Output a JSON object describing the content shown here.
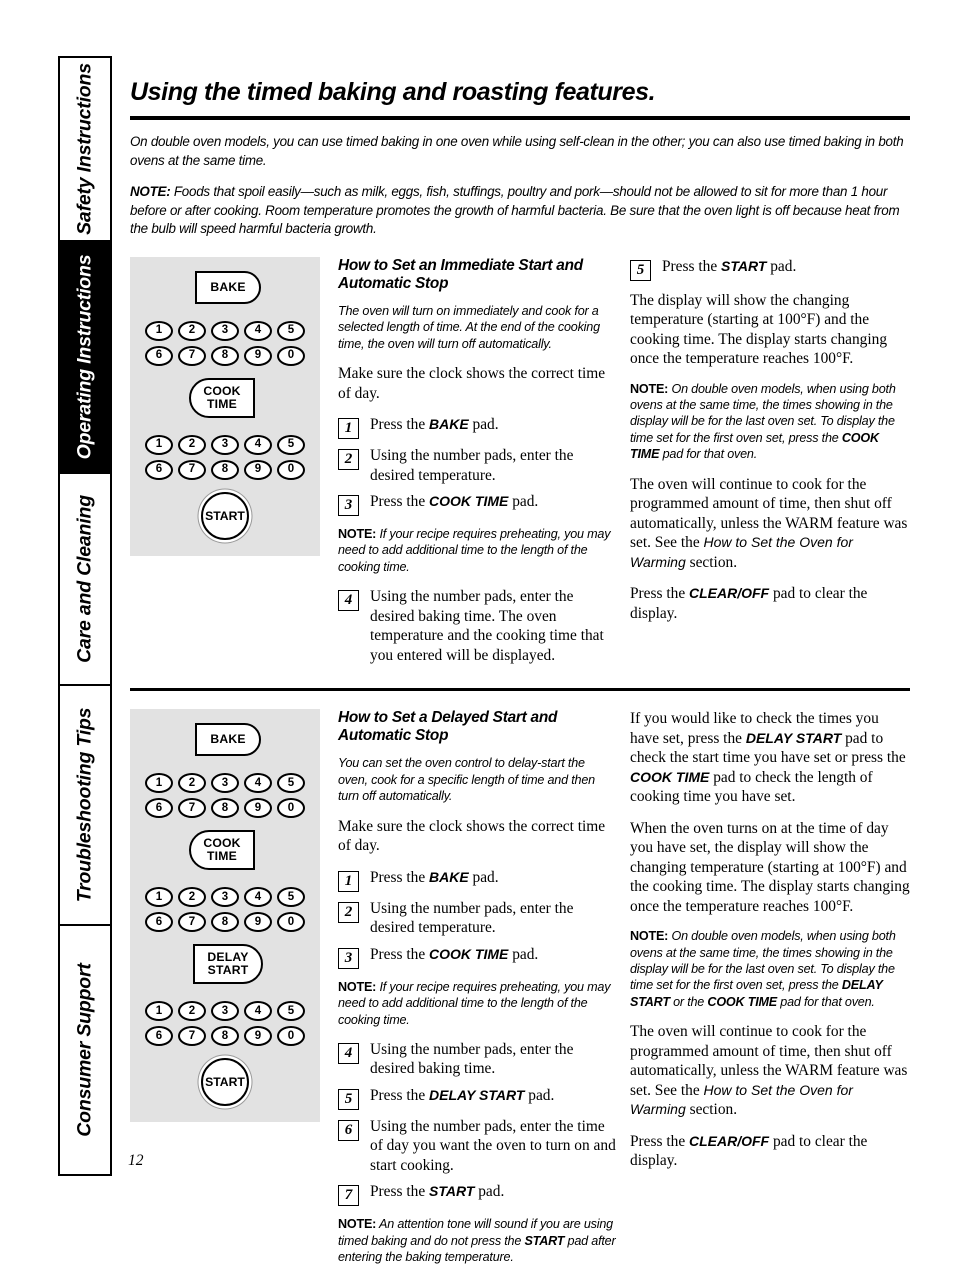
{
  "sidebar": {
    "tabs": [
      {
        "label": "Safety Instructions",
        "active": false
      },
      {
        "label": "Operating Instructions",
        "active": true
      },
      {
        "label": "Care and Cleaning",
        "active": false
      },
      {
        "label": "Troubleshooting Tips",
        "active": false
      },
      {
        "label": "Consumer Support",
        "active": false
      }
    ]
  },
  "page": {
    "title": "Using the timed baking and roasting features.",
    "number": "12",
    "intro": "On double oven models, you can use timed baking in one oven while using self-clean in the other; you can also use timed baking in both ovens at the same time.",
    "intro_note_label": "NOTE:",
    "intro_note_body": " Foods that spoil easily—such as milk, eggs, fish, stuffings, poultry and pork—should not be allowed to sit for more than 1 hour before or after cooking. Room temperature promotes the growth of harmful bacteria. Be sure that the oven light is off because heat from the bulb will speed harmful bacteria growth."
  },
  "keypad_labels": {
    "bake": "BAKE",
    "cook_time_line1": "COOK",
    "cook_time_line2": "TIME",
    "delay_start_line1": "DELAY",
    "delay_start_line2": "START",
    "start": "START",
    "digits_row1": [
      "1",
      "2",
      "3",
      "4",
      "5"
    ],
    "digits_row2": [
      "6",
      "7",
      "8",
      "9",
      "0"
    ]
  },
  "section1": {
    "heading": "How to Set an Immediate Start and Automatic Stop",
    "lead": "The oven will turn on immediately and cook for a selected length of time. At the end of the cooking time, the oven will turn off automatically.",
    "clock_para": "Make sure the clock shows the correct time of day.",
    "steps": [
      {
        "num": "1",
        "pre": "Press the ",
        "pad": "BAKE",
        "post": " pad."
      },
      {
        "num": "2",
        "pre": "Using the number pads, enter the desired temperature.",
        "pad": "",
        "post": ""
      },
      {
        "num": "3",
        "pre": "Press the ",
        "pad": "COOK TIME",
        "post": " pad."
      },
      {
        "num": "4",
        "pre": "Using the number pads, enter the desired baking time. The oven temperature and the cooking time that you entered will be displayed.",
        "pad": "",
        "post": ""
      }
    ],
    "note_preheat_label": "NOTE:",
    "note_preheat_body": " If your recipe requires preheating, you may need to add additional time to the length of the cooking time.",
    "step5": {
      "num": "5",
      "pre": "Press the ",
      "pad": "START",
      "post": " pad."
    },
    "display_para": "The display will show the changing temperature (starting at 100°F) and the cooking time. The display starts changing once the temperature reaches 100°F.",
    "note_double_label": "NOTE:",
    "note_double_a": " On double oven models, when using both ovens at the same time, the times showing in the display will be for the last oven set. To display the time set for the first oven set, press the ",
    "note_double_pad": "COOK TIME",
    "note_double_b": " pad for that oven.",
    "warm_pre": "The oven will continue to cook for the programmed amount of time, then shut off automatically, unless the WARM feature was set. See the ",
    "warm_italic": "How to Set the Oven for Warming",
    "warm_post": " section.",
    "clear_pre": "Press the ",
    "clear_pad": "CLEAR/OFF",
    "clear_post": " pad to clear the display."
  },
  "section2": {
    "heading": "How to Set a Delayed Start and Automatic Stop",
    "lead": "You can set the oven control to delay-start the oven, cook for a specific length of time and then turn off automatically.",
    "clock_para": "Make sure the clock shows the correct time of day.",
    "steps_a": [
      {
        "num": "1",
        "pre": "Press the ",
        "pad": "BAKE",
        "post": " pad."
      },
      {
        "num": "2",
        "pre": "Using the number pads, enter the desired temperature.",
        "pad": "",
        "post": ""
      },
      {
        "num": "3",
        "pre": "Press the ",
        "pad": "COOK TIME",
        "post": " pad."
      }
    ],
    "note_preheat_label": "NOTE:",
    "note_preheat_body": " If your recipe requires preheating, you may need to add additional time to the length of the cooking time.",
    "steps_b": [
      {
        "num": "4",
        "pre": "Using the number pads, enter the desired baking time.",
        "pad": "",
        "post": ""
      },
      {
        "num": "5",
        "pre": "Press the ",
        "pad": "DELAY START",
        "post": " pad."
      },
      {
        "num": "6",
        "pre": "Using the number pads, enter the time of day you want the oven to turn on and start cooking.",
        "pad": "",
        "post": ""
      },
      {
        "num": "7",
        "pre": "Press the ",
        "pad": "START",
        "post": " pad."
      }
    ],
    "note_tone_label": "NOTE:",
    "note_tone_a": " An attention tone will sound if you are using timed baking and do not press the ",
    "note_tone_pad": "START",
    "note_tone_b": " pad after entering the baking temperature.",
    "check_a": "If you would like to check the times you have set, press the ",
    "check_pad1": "DELAY START",
    "check_b": " pad to check the start time you have set or press the ",
    "check_pad2": "COOK TIME",
    "check_c": " pad to check the length of cooking time you have set.",
    "turnon_para": "When the oven turns on at the time of day you have set, the display will show the changing temperature (starting at 100°F) and the cooking time. The display starts changing once the temperature reaches 100°F.",
    "note_double_label": "NOTE:",
    "note_double_a": " On double oven models, when using both ovens at the same time, the times showing in the display will be for the last oven set. To display the time set for the first oven set, press the ",
    "note_double_pad1": "DELAY START",
    "note_double_mid": " or the ",
    "note_double_pad2": "COOK TIME",
    "note_double_b": " pad for that oven.",
    "warm_pre": "The oven will continue to cook for the programmed amount of time, then shut off automatically, unless the WARM feature was set. See the ",
    "warm_italic": "How to Set the Oven for Warming",
    "warm_post": " section.",
    "clear_pre": "Press the ",
    "clear_pad": "CLEAR/OFF",
    "clear_post": " pad to clear the display."
  }
}
